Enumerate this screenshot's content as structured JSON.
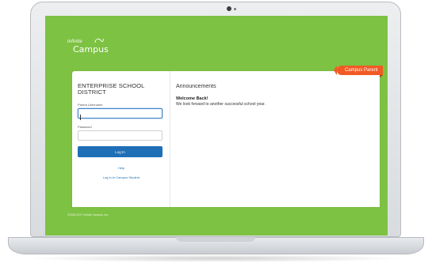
{
  "brand": {
    "small_text": "infinite",
    "big_text": "Campus",
    "screen_bg": "#7dc242",
    "accent_blue": "#1f6fb6",
    "badge_color": "#f15a24"
  },
  "badge": {
    "label": "Campus Parent"
  },
  "login": {
    "district_name": "ENTERPRISE SCHOOL DISTRICT",
    "username_label": "Parent Username",
    "username_value": "",
    "password_label": "Password",
    "password_value": "",
    "login_button": "Log In",
    "help_link": "Help",
    "student_link": "Log in to Campus Student"
  },
  "announcements": {
    "title": "Announcements",
    "heading": "Welcome Back!",
    "message": "We look forward to another successful school year."
  },
  "footer": {
    "copyright": "©2003-2017 Infinite Campus, Inc."
  }
}
